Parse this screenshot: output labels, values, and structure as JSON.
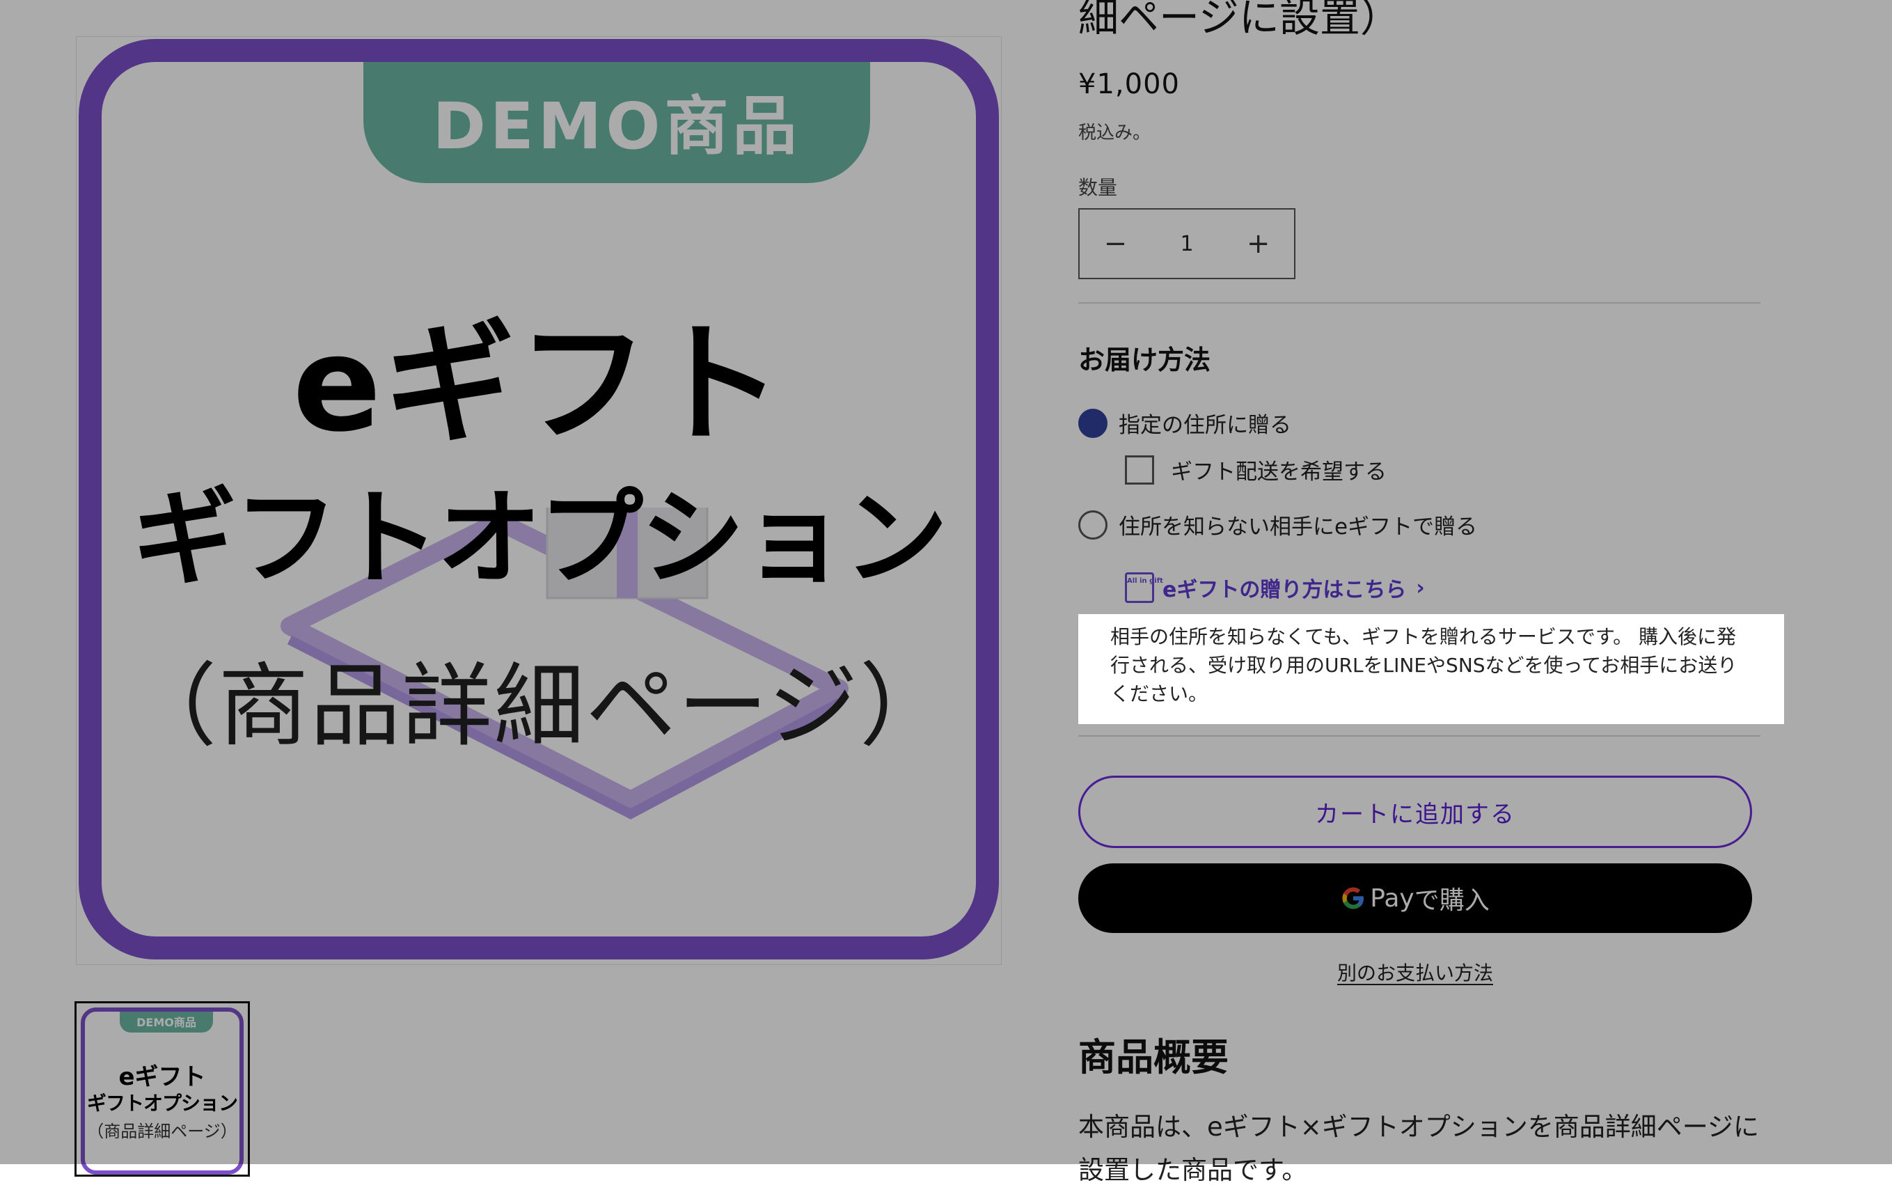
{
  "product": {
    "title": "細ページに設置）",
    "price": "¥1,000",
    "tax_note": "税込み。"
  },
  "media": {
    "demo_label": "DEMO商品",
    "hero_line1": "eギフト",
    "hero_line2": "ギフトオプション",
    "hero_line3": "（商品詳細ページ）",
    "thumb_demo_label": "DEMO商品",
    "thumb_line1": "eギフト",
    "thumb_line2": "ギフトオプション",
    "thumb_line3": "（商品詳細ページ）"
  },
  "quantity": {
    "label": "数量",
    "minus": "−",
    "value": "1",
    "plus": "+"
  },
  "shipping": {
    "title": "お届け方法",
    "option1": "指定の住所に贈る",
    "gift_checkbox": "ギフト配送を希望する",
    "option2": "住所を知らない相手にeギフトで贈る",
    "egift_link": "eギフトの贈り方はこちら",
    "egift_logo": "All in gift",
    "info_text": "相手の住所を知らなくても、ギフトを贈れるサービスです。 購入後に発行される、受け取り用のURLをLINEやSNSなどを使ってお相手にお送りください。"
  },
  "actions": {
    "add_to_cart": "カートに追加する",
    "gpay_text": "Pay",
    "gpay_suffix": "で購入",
    "other_payment": "別のお支払い方法"
  },
  "overview": {
    "title": "商品概要",
    "text": "本商品は、eギフト×ギフトオプションを商品詳細ページに設置した商品です。"
  },
  "colors": {
    "accent_purple": "#7b4fc8",
    "demo_green": "#6db6a4",
    "radio_selected": "#30419a",
    "link_purple": "#5d3ad1"
  }
}
